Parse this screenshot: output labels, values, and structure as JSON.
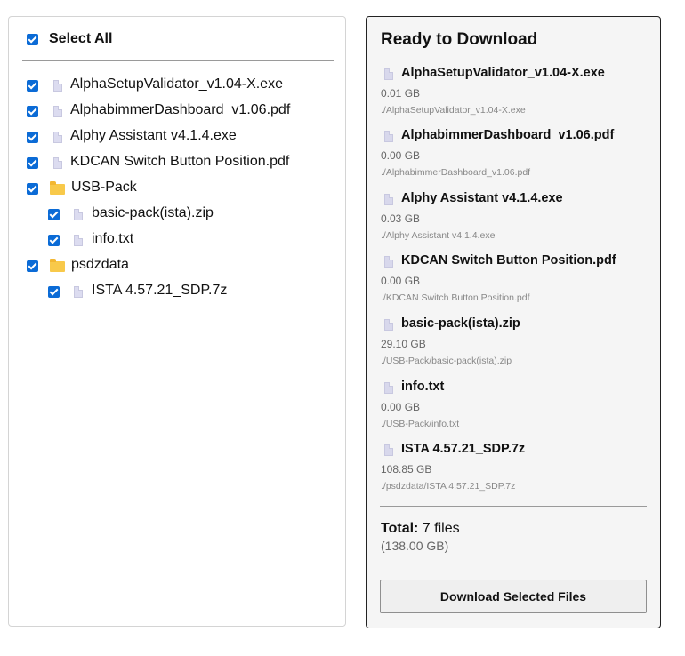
{
  "tree": {
    "select_all_label": "Select All",
    "items": [
      {
        "label": "AlphaSetupValidator_v1.04-X.exe",
        "kind": "file"
      },
      {
        "label": "AlphabimmerDashboard_v1.06.pdf",
        "kind": "file"
      },
      {
        "label": "Alphy Assistant v4.1.4.exe",
        "kind": "file"
      },
      {
        "label": "KDCAN Switch Button Position.pdf",
        "kind": "file"
      },
      {
        "label": "USB-Pack",
        "kind": "folder"
      },
      {
        "label": "basic-pack(ista).zip",
        "kind": "file"
      },
      {
        "label": "info.txt",
        "kind": "file"
      },
      {
        "label": "psdzdata",
        "kind": "folder"
      },
      {
        "label": "ISTA 4.57.21_SDP.7z",
        "kind": "file"
      }
    ]
  },
  "download": {
    "title": "Ready to Download",
    "items": [
      {
        "name": "AlphaSetupValidator_v1.04-X.exe",
        "size": "0.01 GB",
        "path": "./AlphaSetupValidator_v1.04-X.exe"
      },
      {
        "name": "AlphabimmerDashboard_v1.06.pdf",
        "size": "0.00 GB",
        "path": "./AlphabimmerDashboard_v1.06.pdf"
      },
      {
        "name": "Alphy Assistant v4.1.4.exe",
        "size": "0.03 GB",
        "path": "./Alphy Assistant v4.1.4.exe"
      },
      {
        "name": "KDCAN Switch Button Position.pdf",
        "size": "0.00 GB",
        "path": "./KDCAN Switch Button Position.pdf"
      },
      {
        "name": "basic-pack(ista).zip",
        "size": "29.10 GB",
        "path": "./USB-Pack/basic-pack(ista).zip"
      },
      {
        "name": "info.txt",
        "size": "0.00 GB",
        "path": "./USB-Pack/info.txt"
      },
      {
        "name": "ISTA 4.57.21_SDP.7z",
        "size": "108.85 GB",
        "path": "./psdzdata/ISTA 4.57.21_SDP.7z"
      }
    ],
    "total_label": "Total:",
    "total_count": "7 files",
    "total_size": "(138.00 GB)",
    "button_label": "Download Selected Files"
  },
  "colors": {
    "checkbox_accent": "#0b6bd6",
    "folder": "#f8c94a",
    "file_icon": "#dcdcf0"
  }
}
